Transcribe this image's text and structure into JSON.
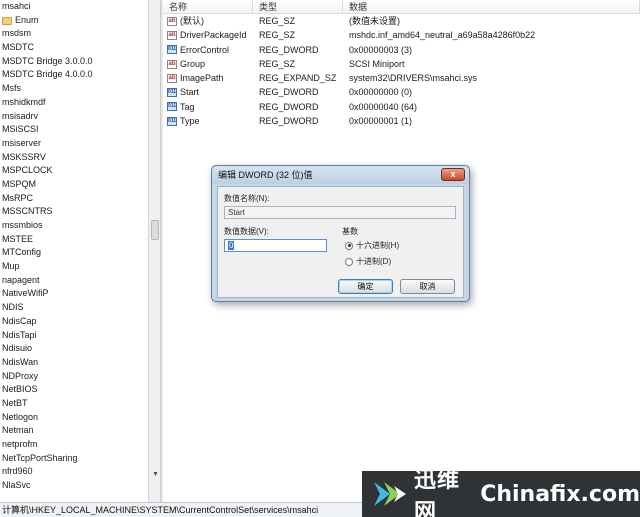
{
  "tree": {
    "items": [
      {
        "label": "msahci",
        "folder": false
      },
      {
        "label": "Enum",
        "folder": true
      },
      {
        "label": "msdsm",
        "folder": false
      },
      {
        "label": "MSDTC",
        "folder": false
      },
      {
        "label": "MSDTC Bridge 3.0.0.0",
        "folder": false
      },
      {
        "label": "MSDTC Bridge 4.0.0.0",
        "folder": false
      },
      {
        "label": "Msfs",
        "folder": false
      },
      {
        "label": "mshidkmdf",
        "folder": false
      },
      {
        "label": "msisadrv",
        "folder": false
      },
      {
        "label": "MSiSCSI",
        "folder": false
      },
      {
        "label": "msiserver",
        "folder": false
      },
      {
        "label": "MSKSSRV",
        "folder": false
      },
      {
        "label": "MSPCLOCK",
        "folder": false
      },
      {
        "label": "MSPQM",
        "folder": false
      },
      {
        "label": "MsRPC",
        "folder": false
      },
      {
        "label": "MSSCNTRS",
        "folder": false
      },
      {
        "label": "mssmbios",
        "folder": false
      },
      {
        "label": "MSTEE",
        "folder": false
      },
      {
        "label": "MTConfig",
        "folder": false
      },
      {
        "label": "Mup",
        "folder": false
      },
      {
        "label": "napagent",
        "folder": false
      },
      {
        "label": "NativeWifiP",
        "folder": false
      },
      {
        "label": "NDIS",
        "folder": false
      },
      {
        "label": "NdisCap",
        "folder": false
      },
      {
        "label": "NdisTapi",
        "folder": false
      },
      {
        "label": "Ndisuio",
        "folder": false
      },
      {
        "label": "NdisWan",
        "folder": false
      },
      {
        "label": "NDProxy",
        "folder": false
      },
      {
        "label": "NetBIOS",
        "folder": false
      },
      {
        "label": "NetBT",
        "folder": false
      },
      {
        "label": "Netlogon",
        "folder": false
      },
      {
        "label": "Netman",
        "folder": false
      },
      {
        "label": "netprofm",
        "folder": false
      },
      {
        "label": "NetTcpPortSharing",
        "folder": false
      },
      {
        "label": "nfrd960",
        "folder": false
      },
      {
        "label": "NlaSvc",
        "folder": false
      }
    ]
  },
  "values": {
    "headers": {
      "name": "名称",
      "type": "类型",
      "data": "数据"
    },
    "rows": [
      {
        "icon": "string-value-icon",
        "glyph": "ab",
        "name": "(默认)",
        "type": "REG_SZ",
        "data": "(数值未设置)"
      },
      {
        "icon": "string-value-icon",
        "glyph": "ab",
        "name": "DriverPackageId",
        "type": "REG_SZ",
        "data": "mshdc.inf_amd64_neutral_a69a58a4286f0b22"
      },
      {
        "icon": "binary-value-icon",
        "glyph": "011",
        "name": "ErrorControl",
        "type": "REG_DWORD",
        "data": "0x00000003 (3)"
      },
      {
        "icon": "string-value-icon",
        "glyph": "ab",
        "name": "Group",
        "type": "REG_SZ",
        "data": "SCSI Miniport"
      },
      {
        "icon": "string-value-icon",
        "glyph": "ab",
        "name": "ImagePath",
        "type": "REG_EXPAND_SZ",
        "data": "system32\\DRIVERS\\msahci.sys"
      },
      {
        "icon": "binary-value-icon",
        "glyph": "011",
        "name": "Start",
        "type": "REG_DWORD",
        "data": "0x00000000 (0)"
      },
      {
        "icon": "binary-value-icon",
        "glyph": "011",
        "name": "Tag",
        "type": "REG_DWORD",
        "data": "0x00000040 (64)"
      },
      {
        "icon": "binary-value-icon",
        "glyph": "011",
        "name": "Type",
        "type": "REG_DWORD",
        "data": "0x00000001 (1)"
      }
    ]
  },
  "dialog": {
    "title": "编辑 DWORD (32 位)值",
    "close": "x",
    "value_name_label": "数值名称(N):",
    "value_name": "Start",
    "value_data_label": "数值数据(V):",
    "value_data": "0",
    "base_label": "基数",
    "hex_label": "十六进制(H)",
    "dec_label": "十进制(D)",
    "ok": "确定",
    "cancel": "取消"
  },
  "statusbar": {
    "path": "计算机\\HKEY_LOCAL_MACHINE\\SYSTEM\\CurrentControlSet\\services\\msahci"
  },
  "watermark": {
    "brand_cn": "迅维网",
    "brand_en": "Chinafix.com"
  }
}
